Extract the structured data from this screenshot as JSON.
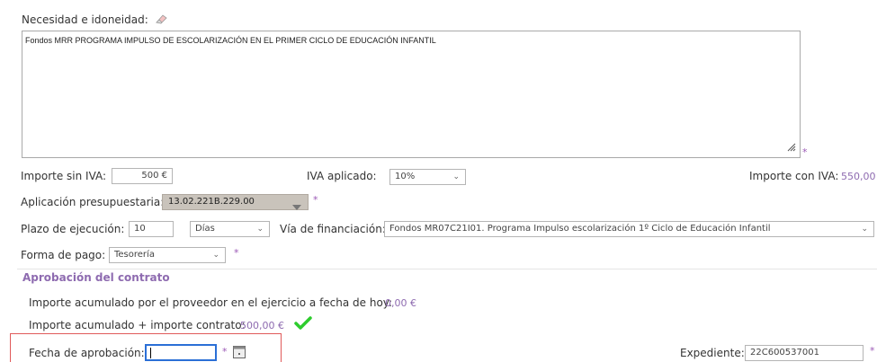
{
  "necesidad": {
    "label": "Necesidad e idoneidad:",
    "text": "Fondos MRR PROGRAMA IMPULSO DE ESCOLARIZACIÓN EN EL PRIMER CICLO DE EDUCACIÓN INFANTIL"
  },
  "importe_sin_iva": {
    "label": "Importe sin IVA:",
    "value": "500 €"
  },
  "iva": {
    "label": "IVA aplicado:",
    "value": "10%"
  },
  "importe_con_iva": {
    "label": "Importe con IVA:",
    "value": "550,00"
  },
  "aplicacion": {
    "label": "Aplicación presupuestaria:",
    "value": "13.02.221B.229.00"
  },
  "plazo": {
    "label": "Plazo de ejecución:",
    "value": "10",
    "unit": "Días"
  },
  "via": {
    "label": "Vía de financiación:",
    "value": "Fondos MR07C21I01. Programa Impulso escolarización 1º Ciclo de Educación Infantil"
  },
  "forma_pago": {
    "label": "Forma de pago:",
    "value": "Tesorería"
  },
  "aprobacion": {
    "title": "Aprobación del contrato",
    "acumulado_label": "Importe acumulado por el proveedor en el ejercicio a fecha de hoy:",
    "acumulado_value": "0,00 €",
    "acumulado_total_label": "Importe acumulado + importe contrato:",
    "acumulado_total_value": "500,00 €",
    "fecha_label": "Fecha de aprobación:",
    "fecha_value": "",
    "expediente_label": "Expediente:",
    "expediente_value": "22C600537001"
  },
  "required_mark": "*",
  "colors": {
    "accent": "#8e6bb0",
    "check": "#2ecc2e",
    "highlight": "#e05a5a",
    "select_bg": "#c9c3bb"
  }
}
